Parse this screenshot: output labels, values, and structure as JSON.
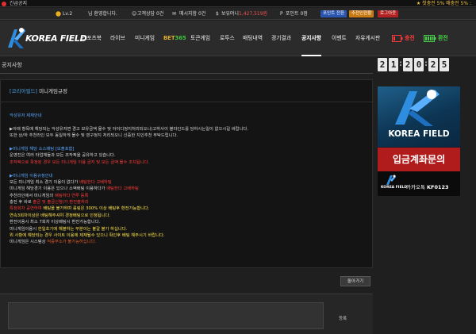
{
  "notice_bar": {
    "label": "긴급공지",
    "ticker": "★ 첫충전 5% 매충전 5% :"
  },
  "user_bar": {
    "level": "Lv.2",
    "greeting": "님 환영합니다.",
    "support": "고객상담 0건",
    "messages": "메시지함 0건",
    "money_label": "보유머니",
    "money_value": "1,427,519원",
    "points_label": "포인트 0점",
    "point_convert": "포인트 전환",
    "attendance": "추천인현황",
    "logout": "로그아웃"
  },
  "nav": {
    "brand": "KOREA FIELD",
    "items": [
      "스포츠북",
      "라이브",
      "미니게임",
      "토큰게임",
      "로투스",
      "배팅내역",
      "경기결과",
      "공지사항",
      "이벤트",
      "자유게시판"
    ],
    "bet365_a": "BET",
    "bet365_b": "365",
    "charge": "충전",
    "exchange": "환전",
    "active": "공지사항"
  },
  "page": {
    "title": "공지사항",
    "back": "돌아가기",
    "submit": "등록"
  },
  "clock": [
    "2",
    "1",
    "2",
    "0",
    "2",
    "5"
  ],
  "article": {
    "category": "[코리아필드]",
    "title": "미니게임규정",
    "lines": [
      {
        "c": "blue",
        "t": "악성유저 제재안내"
      },
      {
        "c": "",
        "t": ""
      },
      {
        "c": "",
        "t": "▶아래 항목에 해당되는 악성유저면 경고 보유금액 몰수 및 아이디정지처리되오니(고하사이 블라인드를 당하시는일이 없으시길 바랍니다."
      },
      {
        "c": "",
        "t": "또한 상/하 추천라인 모두 동일하게 몰수 및 영구정지 처리되오니 신중한 지인추천 부탁드립니다."
      },
      {
        "c": "",
        "t": ""
      },
      {
        "c": "blue",
        "t": "▶미니게임 해당 소스배팅 [모출포함]"
      },
      {
        "c": "",
        "t": "운영진은 여러 타업체들과 모든 조작픽을 공유하고 있습니다."
      },
      {
        "c": "red",
        "t": "조작픽으로 확정된 경우 모든 미니게임 이용 금지 및 모든 금액 몰수 조치됩니다."
      },
      {
        "c": "",
        "t": ""
      },
      {
        "c": "blue",
        "t": "▶미니게임 이용규정안내"
      },
      {
        "c": "",
        "t": "모든 미니게임 최소 경기 이용이 없다가 [r]배팅한다 고베하팅"
      },
      {
        "c": "",
        "t": "미니게임 해당경기 이용은 있으나 소액배팅 이용하다가 [r]배팅한다 고베하팅"
      },
      {
        "c": "",
        "t": "추천라인에서 미니게임의 [r]배팅하다 연루 등록"
      },
      {
        "c": "",
        "t": "충전 후 바로 [r]출금 및 출금신청/가 환전출처리"
      },
      {
        "c": "",
        "t": "[r]특정회차 공연하여 [y]배팅을 불가하며 롤링은 300% 이상 배팅후 환전가능합니다."
      },
      {
        "c": "yel",
        "t": "연속3회차이상은 배팅해주셔야 경정배팅으로 인정됩니다."
      },
      {
        "c": "",
        "t": "환전이용시 최소 7회차 이상배팅시 환전가능합니다."
      },
      {
        "c": "",
        "t": "미니게임이용시 [y]한일초기[y]에 해볼하는 부분이는 불갈 불가 하십니다."
      },
      {
        "c": "yel",
        "t": "위 사항에 해당되는 경우 사이트 이용에 제재될수 있으니 확인후 배팅 해주시기 바랍니다."
      },
      {
        "c": "",
        "t": "미니게임은 시스템상 [o]적중부소가 불가능하십니다."
      }
    ]
  },
  "ad": {
    "brand": "KOREA FIELD",
    "headline": "입금계좌문의",
    "kakao_label": "카카오톡",
    "kakao_id": "KF0123",
    "small_brand": "KOREA FIELD"
  },
  "colors": {
    "accent_blue": "#4aa0e0",
    "alert_red": "#ff3b3b",
    "highlight_yellow": "#ffe54a",
    "charge_red": "#ff3a3a",
    "exchange_green": "#4ad04a",
    "ad_red": "#b01c1c"
  }
}
